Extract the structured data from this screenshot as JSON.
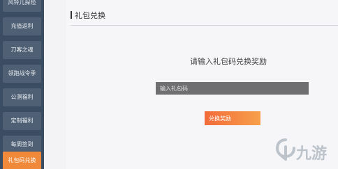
{
  "sidebar": {
    "items": [
      {
        "label": "风铃儿探险",
        "active": false
      },
      {
        "label": "充值返利",
        "active": false
      },
      {
        "label": "刀客之魂",
        "active": false
      },
      {
        "label": "领跑战令季",
        "active": false
      },
      {
        "label": "公测福利",
        "active": false
      },
      {
        "label": "定制福利",
        "active": false
      },
      {
        "label": "每周签到",
        "active": false
      },
      {
        "label": "礼包码兑换",
        "active": true
      }
    ]
  },
  "main": {
    "title": "礼包兑换",
    "prompt": "请输入礼包码兑换奖励",
    "input_placeholder": "输入礼包码",
    "input_value": "",
    "redeem_label": "兑换奖励"
  },
  "watermark": {
    "text": "九游",
    "icon": "nine-game-logo-icon"
  },
  "colors": {
    "sidebar_bg": "#3b4d63",
    "sidebar_item": "#4f6075",
    "active_item": "#f08a3a",
    "button_start": "#f26b3a",
    "button_end": "#f7a04a",
    "input_bg": "#6f6f72"
  }
}
